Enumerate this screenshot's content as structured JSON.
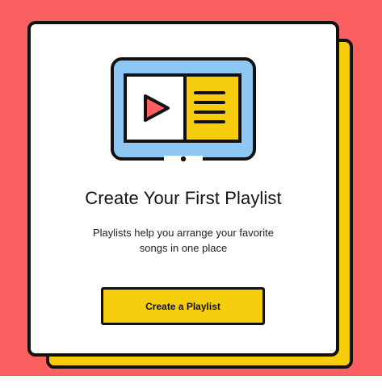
{
  "empty_state": {
    "title": "Create Your First Playlist",
    "description": "Playlists help you arrange your favorite songs in one place",
    "button_label": "Create a Playlist"
  },
  "illustration": {
    "icon": "playlist-tablet-icon",
    "parts": [
      "play-icon",
      "list-lines-icon"
    ]
  },
  "colors": {
    "background": "#fb6060",
    "accent_yellow": "#f6cd0d",
    "screen_blue": "#8ec7f3",
    "play_red": "#fb6060",
    "outline": "#111111",
    "card": "#ffffff"
  }
}
